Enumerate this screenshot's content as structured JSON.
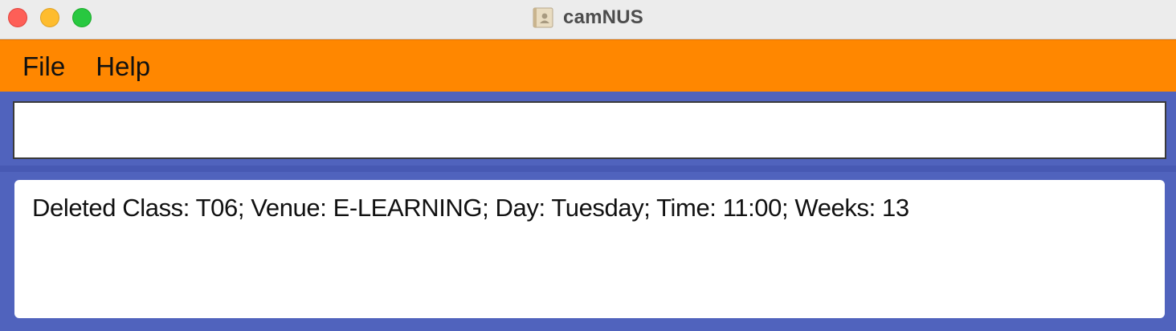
{
  "window": {
    "title": "camNUS",
    "app_icon": "address-book-icon"
  },
  "menu": {
    "items": [
      {
        "label": "File"
      },
      {
        "label": "Help"
      }
    ]
  },
  "command": {
    "value": "",
    "placeholder": ""
  },
  "result": {
    "text": "Deleted Class: T06; Venue: E-LEARNING; Day: Tuesday; Time: 11:00; Weeks: 13"
  },
  "colors": {
    "menubar": "#ff8700",
    "background": "#5063bd",
    "titlebar": "#ececec"
  }
}
